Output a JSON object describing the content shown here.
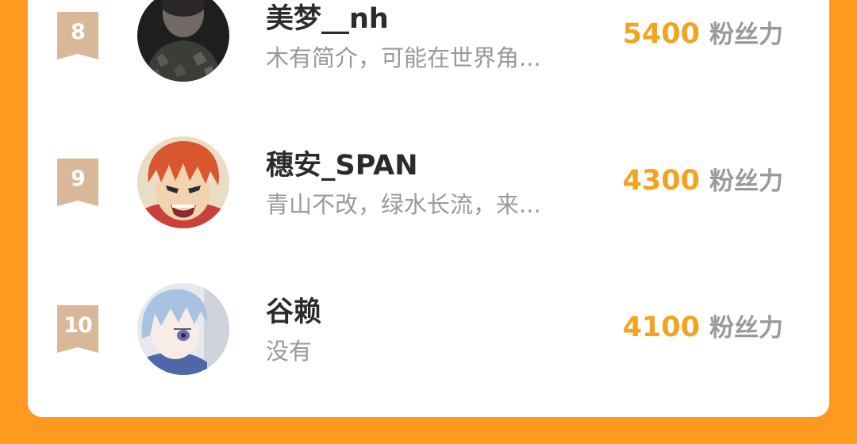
{
  "colors": {
    "page_background": "#ff9a21",
    "card_background": "#ffffff",
    "badge": "#d9b899",
    "fans_count": "#f3a31e",
    "name": "#2b2b2b",
    "secondary_text": "#9a9a9a"
  },
  "ranking": [
    {
      "rank": "8",
      "avatar_icon": "avatar-dark-jacket-person",
      "name": "美梦__nh",
      "bio": "木有简介，可能在世界角...",
      "fans_count": "5400",
      "fans_label": "粉丝力"
    },
    {
      "rank": "9",
      "avatar_icon": "avatar-red-hair-anime",
      "name": "穗安_SPAN",
      "bio": "青山不改，绿水长流，来...",
      "fans_count": "4300",
      "fans_label": "粉丝力"
    },
    {
      "rank": "10",
      "avatar_icon": "avatar-blue-hair-anime",
      "name": "谷赖",
      "bio": "没有",
      "fans_count": "4100",
      "fans_label": "粉丝力"
    }
  ]
}
